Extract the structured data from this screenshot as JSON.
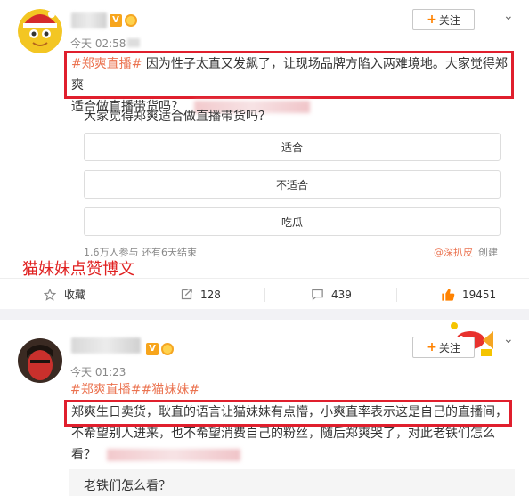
{
  "post1": {
    "time": "今天 02:58",
    "follow_label": "关注",
    "tag": "#郑爽直播#",
    "text_part1": " 因为性子太直又发飙了，让现场品牌方陷入两难境地。大家觉得郑爽",
    "text_part2": "适合做直播带货吗？",
    "poll": {
      "question": "大家觉得郑爽适合做直播带货吗？",
      "options": [
        "适合",
        "不适合",
        "吃瓜"
      ],
      "meta": "1.6万人参与 还有6天结束",
      "source": "@深扒皮",
      "create_label": "创建"
    },
    "overlay_text": "猫妹妹点赞博文",
    "actions": {
      "favorite": "收藏",
      "repost": "128",
      "comment": "439",
      "like": "19451"
    }
  },
  "post2": {
    "time": "今天 01:23",
    "follow_label": "关注",
    "tags": "#郑爽直播##猫妹妹#",
    "line1": "郑爽生日卖货，耿直的语言让猫妹妹有点懵，小爽直率表示这是自己的直播间，",
    "line2": "不希望别人进来，也不希望消费自己的粉丝，随后郑爽哭了，对此老铁们怎么",
    "line3": "看？",
    "poll_question": "老铁们怎么看？"
  },
  "colors": {
    "accent_orange": "#ff8200",
    "tag_color": "#eb7350",
    "highlight_red": "#e01f2d"
  }
}
